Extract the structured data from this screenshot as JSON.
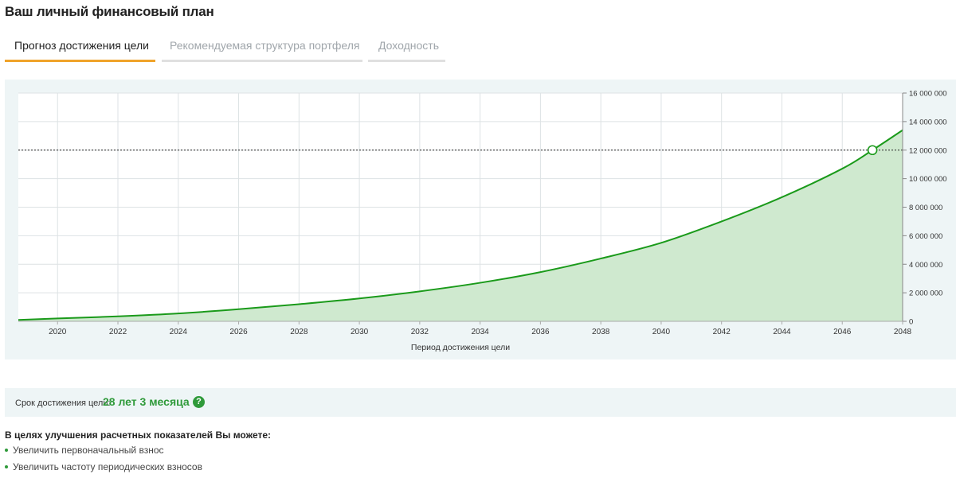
{
  "page": {
    "title": "Ваш личный финансовый план"
  },
  "tabs": [
    {
      "label": "Прогноз достижения цели",
      "active": true
    },
    {
      "label": "Рекомендуемая структура портфеля",
      "active": false
    },
    {
      "label": "Доходность",
      "active": false
    }
  ],
  "colors": {
    "accent_tab": "#f0a32a",
    "line": "#1a9a1a",
    "area": "#cfe9cf",
    "panel_bg": "#eef5f6",
    "success_text": "#2f9a3a"
  },
  "chart_data": {
    "type": "area",
    "xlabel": "Период достижения цели",
    "ylabel": "",
    "xlim": [
      2018.7,
      2048
    ],
    "ylim": [
      0,
      16000000
    ],
    "x_ticks": [
      2020,
      2022,
      2024,
      2026,
      2028,
      2030,
      2032,
      2034,
      2036,
      2038,
      2040,
      2042,
      2044,
      2046,
      2048
    ],
    "y_ticks": [
      0,
      2000000,
      4000000,
      6000000,
      8000000,
      10000000,
      12000000,
      14000000,
      16000000
    ],
    "y_tick_labels": [
      "0",
      "2 000 000",
      "4 000 000",
      "6 000 000",
      "8 000 000",
      "10 000 000",
      "12 000 000",
      "14 000 000",
      "16 000 000"
    ],
    "y_axis_position": "right",
    "grid": true,
    "series": [
      {
        "x": [
          2018.7,
          2020,
          2022,
          2024,
          2026,
          2028,
          2030,
          2032,
          2034,
          2036,
          2038,
          2040,
          2042,
          2044,
          2046,
          2047,
          2048
        ],
        "values": [
          100000,
          200000,
          350000,
          550000,
          850000,
          1200000,
          1600000,
          2100000,
          2700000,
          3450000,
          4400000,
          5500000,
          7000000,
          8700000,
          10700000,
          12000000,
          13400000
        ]
      }
    ],
    "target": {
      "value": 12000000,
      "year": 2047,
      "line_style": "dotted"
    }
  },
  "term": {
    "label": "Срок достижения цели:",
    "value": "28 лет 3 месяца",
    "help_symbol": "?"
  },
  "tips": {
    "title": "В целях улучшения расчетных показателей Вы можете:",
    "items": [
      "Увеличить первоначальный взнос",
      "Увеличить частоту периодических взносов"
    ]
  }
}
